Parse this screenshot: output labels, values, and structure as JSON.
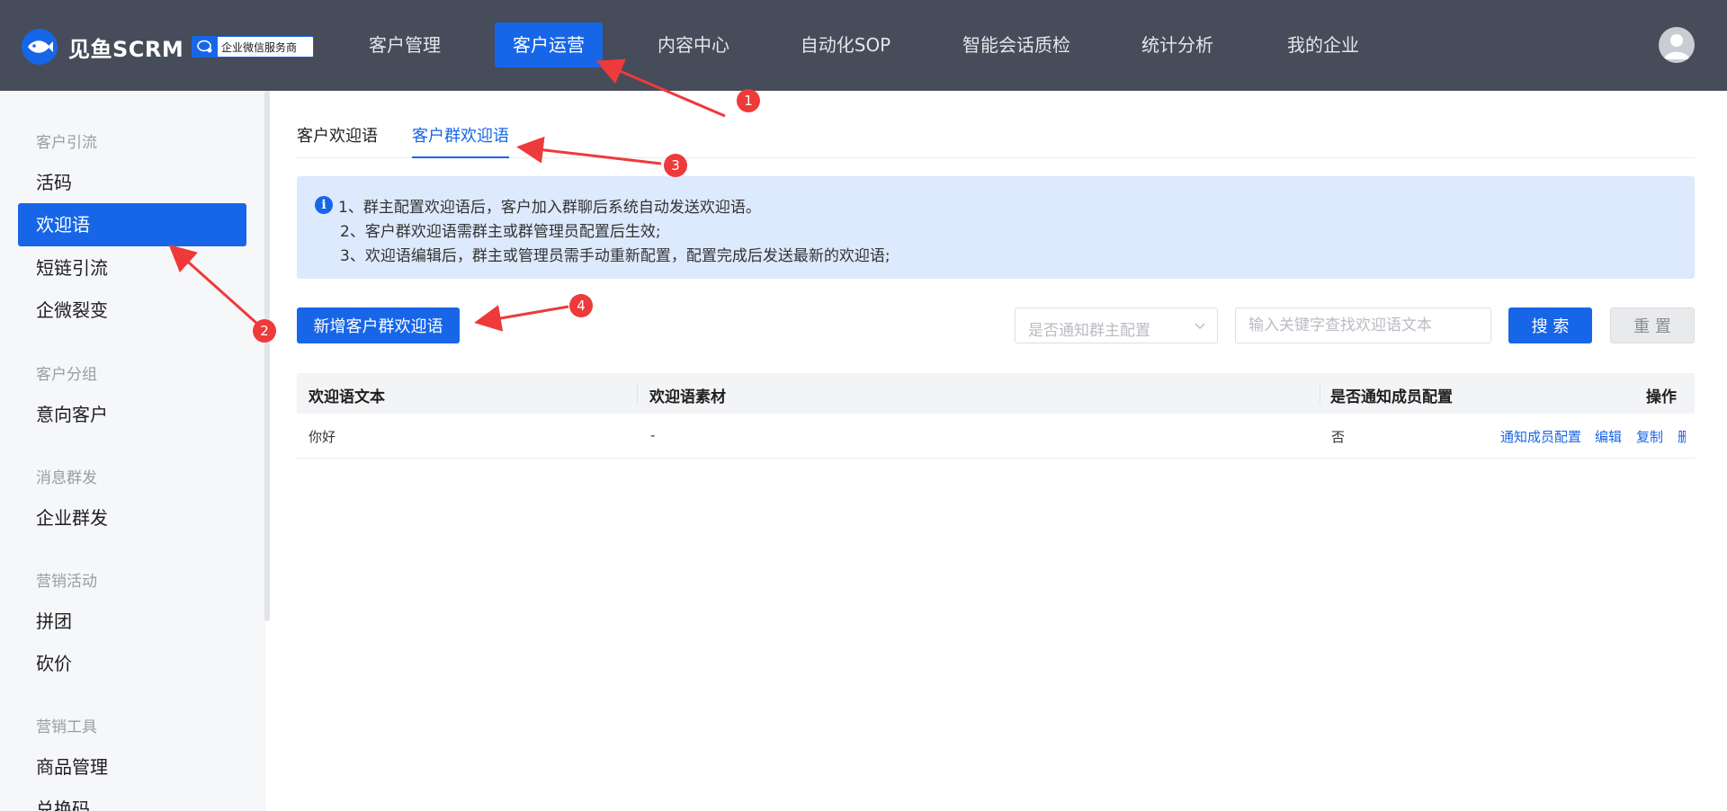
{
  "brand": {
    "name": "见鱼SCRM",
    "badge": "企业微信服务商"
  },
  "nav": [
    {
      "label": "客户管理"
    },
    {
      "label": "客户运营"
    },
    {
      "label": "内容中心"
    },
    {
      "label": "自动化SOP"
    },
    {
      "label": "智能会话质检"
    },
    {
      "label": "统计分析"
    },
    {
      "label": "我的企业"
    }
  ],
  "sidebar": {
    "groups": [
      {
        "title": "客户引流",
        "items": [
          "活码",
          "欢迎语",
          "短链引流",
          "企微裂变"
        ]
      },
      {
        "title": "客户分组",
        "items": [
          "意向客户"
        ]
      },
      {
        "title": "消息群发",
        "items": [
          "企业群发"
        ]
      },
      {
        "title": "营销活动",
        "items": [
          "拼团",
          "砍价"
        ]
      },
      {
        "title": "营销工具",
        "items": [
          "商品管理",
          "兑换码"
        ]
      }
    ]
  },
  "tabs": [
    {
      "label": "客户欢迎语"
    },
    {
      "label": "客户群欢迎语"
    }
  ],
  "notice": {
    "lines": [
      "1、群主配置欢迎语后，客户加入群聊后系统自动发送欢迎语。",
      "2、客户群欢迎语需群主或群管理员配置后生效;",
      "3、欢迎语编辑后，群主或管理员需手动重新配置，配置完成后发送最新的欢迎语;"
    ]
  },
  "toolbar": {
    "add_label": "新增客户群欢迎语",
    "select_placeholder": "是否通知群主配置",
    "search_placeholder": "输入关键字查找欢迎语文本",
    "search_label": "搜 索",
    "reset_label": "重 置"
  },
  "table": {
    "columns": [
      "欢迎语文本",
      "欢迎语素材",
      "是否通知成员配置",
      "操作"
    ],
    "rows": [
      {
        "text": "你好",
        "material": "-",
        "notify": "否",
        "actions": [
          "通知成员配置",
          "编辑",
          "复制",
          "删除"
        ]
      }
    ]
  },
  "annotations": [
    "1",
    "2",
    "3",
    "4"
  ],
  "colors": {
    "accent": "#1766e8",
    "topbar": "#464c59",
    "annotation": "#ee3a3a"
  }
}
